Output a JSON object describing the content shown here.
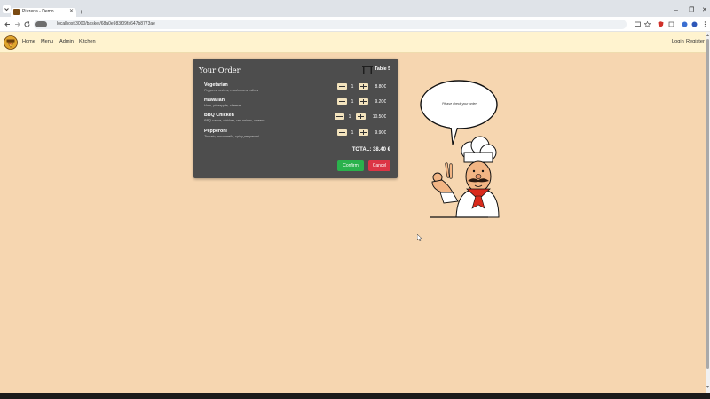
{
  "browser": {
    "tab_title": "Pizzeria - Demo",
    "url_chip": "⊕",
    "url": "localhost:3000/basket/68a0e983f09fa647b8773ae"
  },
  "navbar": {
    "links": [
      "Home",
      "Menu",
      "Admin",
      "Kitchen"
    ],
    "right_links": [
      "Login",
      "Register"
    ]
  },
  "order": {
    "title": "Your Order",
    "table_label": "Table 5",
    "items": [
      {
        "name": "Vegetarian",
        "description": "Peppers, onions, mushrooms, olives",
        "quantity": "1",
        "price": "8.80€"
      },
      {
        "name": "Hawaiian",
        "description": "Ham, pineapple, cheese",
        "quantity": "1",
        "price": "9.20€"
      },
      {
        "name": "BBQ Chicken",
        "description": "BBQ sauce, chicken, red onions, cheese",
        "quantity": "1",
        "price": "10.50€"
      },
      {
        "name": "Pepperoni",
        "description": "Tomato, mozzarella, spicy pepperoni",
        "quantity": "1",
        "price": "9.90€"
      }
    ],
    "total": "TOTAL: 38.40 €",
    "confirm_label": "Confirm",
    "cancel_label": "Cancel"
  },
  "chef": {
    "speech": "Please check your order!"
  },
  "colors": {
    "page_bg": "#f6d6b0",
    "navbar_bg": "#fff3cf",
    "card_bg": "#4d4d4d",
    "confirm": "#2ab24c",
    "cancel": "#dc3545"
  }
}
